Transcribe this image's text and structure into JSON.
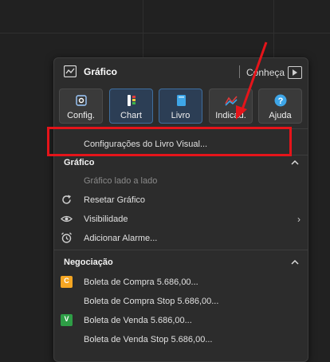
{
  "window": {
    "title": "Gráfico",
    "learn_label": "Conheça"
  },
  "toolbar": {
    "buttons": [
      {
        "label": "Config.",
        "icon": "settings-icon"
      },
      {
        "label": "Chart",
        "icon": "chart-icon"
      },
      {
        "label": "Livro",
        "icon": "book-icon"
      },
      {
        "label": "Indicad.",
        "icon": "indicators-icon"
      },
      {
        "label": "Ajuda",
        "icon": "help-icon"
      }
    ]
  },
  "menu": {
    "book_settings": "Configurações do Livro Visual...",
    "chart_section": {
      "title": "Gráfico",
      "items": [
        {
          "label": "Gráfico lado a lado",
          "disabled": true
        },
        {
          "label": "Resetar Gráfico",
          "icon": "reset-icon"
        },
        {
          "label": "Visibilidade",
          "icon": "eye-icon"
        },
        {
          "label": "Adicionar Alarme...",
          "icon": "alarm-icon"
        }
      ]
    },
    "trading_section": {
      "title": "Negociação",
      "items": [
        {
          "label": "Boleta de Compra",
          "badge": "C",
          "price": "5.686,00..."
        },
        {
          "label": "Boleta de Compra Stop",
          "price": "5.686,00..."
        },
        {
          "label": "Boleta de Venda",
          "badge": "V",
          "price": "5.686,00..."
        },
        {
          "label": "Boleta de Venda Stop",
          "price": "5.686,00..."
        }
      ]
    }
  },
  "colors": {
    "background": "#212121",
    "menu_bg": "#2c2c2c",
    "highlight": "#e5141a",
    "buy_badge": "#f5a623",
    "sell_badge": "#2e9e46",
    "active_tool": "#2c3e55"
  }
}
